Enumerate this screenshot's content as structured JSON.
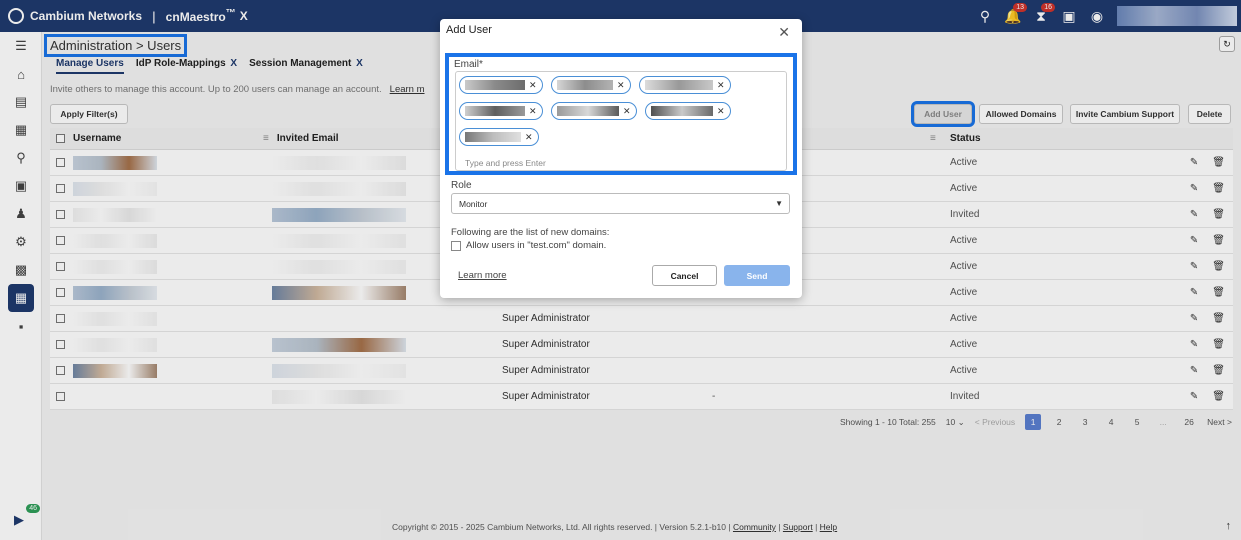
{
  "topbar": {
    "brand": "Cambium Networks",
    "divider": "|",
    "product_prefix": "cn",
    "product": "Maestro",
    "product_tm": "™",
    "product_suffix": "X",
    "notifications_count": "13",
    "alarms_count": "16",
    "icons": [
      "search-icon",
      "bell-icon",
      "signal-icon",
      "chat-icon",
      "user-icon"
    ]
  },
  "sidebar": {
    "icons": [
      "menu-icon",
      "home-icon",
      "monitor-icon",
      "table-icon",
      "location-icon",
      "dashboard-icon",
      "users-icon",
      "settings-icon",
      "apps-icon",
      "admin-icon",
      "report-icon"
    ],
    "active_index": 9,
    "bottom_badge": "46"
  },
  "header": {
    "breadcrumb": "Administration > Users"
  },
  "tabs": [
    {
      "label": "Manage Users",
      "closable": ""
    },
    {
      "label": "IdP Role-Mappings",
      "closable": "X"
    },
    {
      "label": "Session Management",
      "closable": "X"
    }
  ],
  "info": {
    "text": "Invite others to manage this account. Up to 200 users can manage an account.",
    "link": "Learn m"
  },
  "toolbar": {
    "apply_filter": "Apply Filter(s)",
    "add_user": "Add User",
    "allowed_domains": "Allowed Domains",
    "invite_support": "Invite Cambium Support",
    "delete": "Delete"
  },
  "table": {
    "columns": [
      "Username",
      "Invited Email",
      "Status"
    ],
    "rows": [
      {
        "role": "",
        "status": "Active"
      },
      {
        "role": "",
        "status": "Active"
      },
      {
        "role": "",
        "status": "Invited"
      },
      {
        "role": "",
        "status": "Active"
      },
      {
        "role": "",
        "status": "Active"
      },
      {
        "role": "",
        "status": "Active"
      },
      {
        "role": "Super Administrator",
        "status": "Active"
      },
      {
        "role": "Super Administrator",
        "status": "Active"
      },
      {
        "role": "Super Administrator",
        "status": "Active"
      },
      {
        "role": "Super Administrator",
        "status": "Invited"
      }
    ],
    "last_row_dash": "-"
  },
  "pager": {
    "summary": "Showing 1 - 10 Total: 255",
    "per_page": "10",
    "previous": "< Previous",
    "pages": [
      "1",
      "2",
      "3",
      "4",
      "5",
      "...",
      "26"
    ],
    "next": "Next >"
  },
  "footer": {
    "copyright": "Copyright © 2015 - 2025 Cambium Networks, Ltd. All rights reserved.  |  Version 5.2.1-b10  |",
    "community": "Community",
    "support": "Support",
    "help": "Help",
    "sep": "|"
  },
  "modal": {
    "title": "Add User",
    "email_label": "Email*",
    "email_placeholder": "Type and press Enter",
    "chip_count": 7,
    "role_label": "Role",
    "role_value": "Monitor",
    "domains_text": "Following are the list of new domains:",
    "allow_text": "Allow users in \"test.com\" domain.",
    "learn_more": "Learn more",
    "cancel": "Cancel",
    "send": "Send"
  },
  "colors": {
    "topbar": "#1f3a6e",
    "highlight": "#1a73e8",
    "chip_border": "#4a8fd6",
    "send_button": "#89b4ec"
  }
}
